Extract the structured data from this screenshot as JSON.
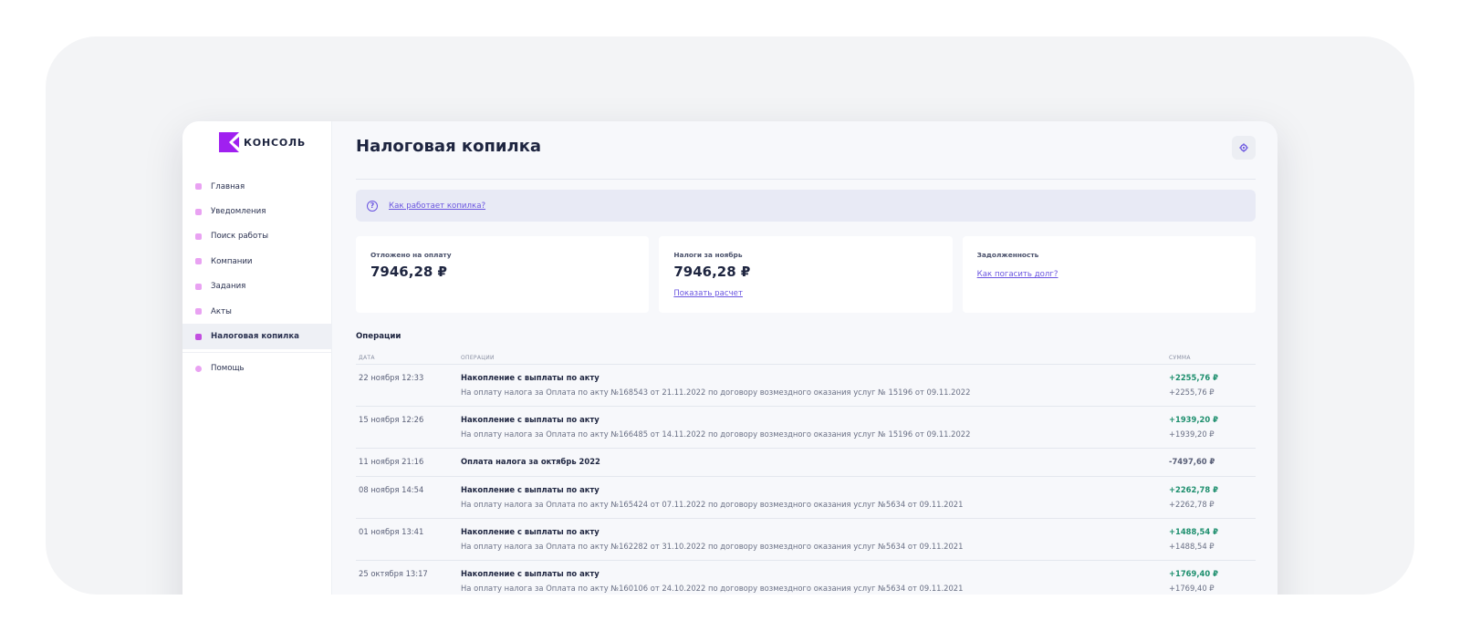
{
  "brand": {
    "name": "КОНСОЛЬ"
  },
  "colors": {
    "accent": "#6a55e0",
    "logo": "#a020f0",
    "positive": "#1e8f6e",
    "nav_icon": "#e9a2f2"
  },
  "sidebar": {
    "items": [
      {
        "label": "Главная",
        "icon": "home-icon"
      },
      {
        "label": "Уведомления",
        "icon": "bell-icon"
      },
      {
        "label": "Поиск работы",
        "icon": "search-icon"
      },
      {
        "label": "Компании",
        "icon": "building-icon"
      },
      {
        "label": "Задания",
        "icon": "tasks-icon"
      },
      {
        "label": "Акты",
        "icon": "document-icon"
      },
      {
        "label": "Налоговая копилка",
        "icon": "piggy-bank-icon",
        "active": true
      }
    ],
    "help": {
      "label": "Помощь",
      "icon": "help-icon"
    }
  },
  "header": {
    "title": "Налоговая копилка",
    "settings_icon": "gear-icon"
  },
  "info": {
    "icon": "question-icon",
    "link": "Как работает копилка?"
  },
  "cards": [
    {
      "label": "Отложено на оплату",
      "value": "7946,28 ₽"
    },
    {
      "label": "Налоги за ноябрь",
      "value": "7946,28 ₽",
      "link": "Показать расчет"
    },
    {
      "label": "Задолженность",
      "link": "Как погасить долг?"
    }
  ],
  "operations": {
    "title": "Операции",
    "columns": {
      "date": "ДАТА",
      "op": "ОПЕРАЦИИ",
      "sum": "СУММА"
    },
    "rows": [
      {
        "date": "22 ноября 12:33",
        "title": "Накопление с выплаты по акту",
        "sub": "На оплату налога за Оплата по акту №168543 от 21.11.2022 по договору возмездного оказания услуг № 15196 от 09.11.2022",
        "sum": "+2255,76 ₽",
        "sum_sub": "+2255,76 ₽"
      },
      {
        "date": "15 ноября 12:26",
        "title": "Накопление с выплаты по акту",
        "sub": "На оплату налога за Оплата по акту №166485 от 14.11.2022 по договору возмездного оказания услуг № 15196 от 09.11.2022",
        "sum": "+1939,20 ₽",
        "sum_sub": "+1939,20 ₽"
      },
      {
        "date": "11 ноября 21:16",
        "title": "Оплата налога за октябрь 2022",
        "sum": "-7497,60 ₽"
      },
      {
        "date": "08 ноября 14:54",
        "title": "Накопление с выплаты по акту",
        "sub": "На оплату налога за Оплата по акту №165424 от 07.11.2022 по договору возмездного оказания услуг №5634 от 09.11.2021",
        "sum": "+2262,78 ₽",
        "sum_sub": "+2262,78 ₽"
      },
      {
        "date": "01 ноября 13:41",
        "title": "Накопление с выплаты по акту",
        "sub": "На оплату налога за Оплата по акту №162282 от 31.10.2022 по договору возмездного оказания услуг №5634 от 09.11.2021",
        "sum": "+1488,54 ₽",
        "sum_sub": "+1488,54 ₽"
      },
      {
        "date": "25 октября 13:17",
        "title": "Накопление с выплаты по акту",
        "sub": "На оплату налога за Оплата по акту №160106 от 24.10.2022 по договору возмездного оказания услуг №5634 от 09.11.2021",
        "sum": "+1769,40 ₽",
        "sum_sub": "+1769,40 ₽"
      }
    ]
  }
}
